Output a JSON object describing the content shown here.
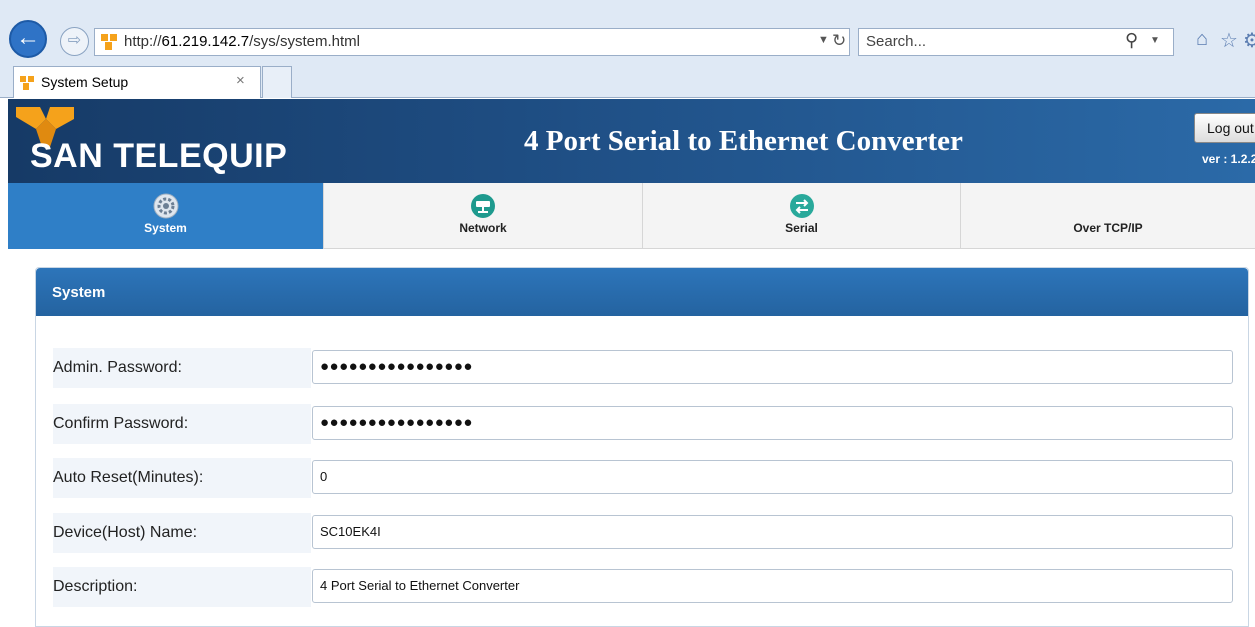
{
  "browser": {
    "url_prefix": "http://",
    "url_host": "61.219.142.7",
    "url_path": "/sys/system.html",
    "search_placeholder": "Search...",
    "tab_title": "System Setup",
    "tab_close": "×"
  },
  "header": {
    "logo_text": "SAN TELEQUIP",
    "title": "4 Port Serial to Ethernet Converter",
    "logout_label": "Log out",
    "version": "ver : 1.2.2"
  },
  "nav": {
    "items": [
      {
        "label": "System",
        "icon": "system-gear-icon",
        "active": true
      },
      {
        "label": "Network",
        "icon": "network-icon",
        "active": false
      },
      {
        "label": "Serial",
        "icon": "serial-arrows-icon",
        "active": false
      },
      {
        "label": "Over TCP/IP",
        "icon": "",
        "active": false
      }
    ]
  },
  "panel": {
    "title": "System",
    "fields": [
      {
        "label": "Admin. Password:",
        "value": "●●●●●●●●●●●●●●●●"
      },
      {
        "label": "Confirm Password:",
        "value": "●●●●●●●●●●●●●●●●"
      },
      {
        "label": "Auto Reset(Minutes):",
        "value": "0"
      },
      {
        "label": "Device(Host) Name:",
        "value": "SC10EK4I"
      },
      {
        "label": "Description:",
        "value": "4 Port Serial to Ethernet Converter"
      }
    ]
  },
  "colors": {
    "header_start": "#163a66",
    "header_end": "#2b6aa8",
    "active_tab": "#2f7fc7",
    "panel_head": "#2d75ba"
  }
}
